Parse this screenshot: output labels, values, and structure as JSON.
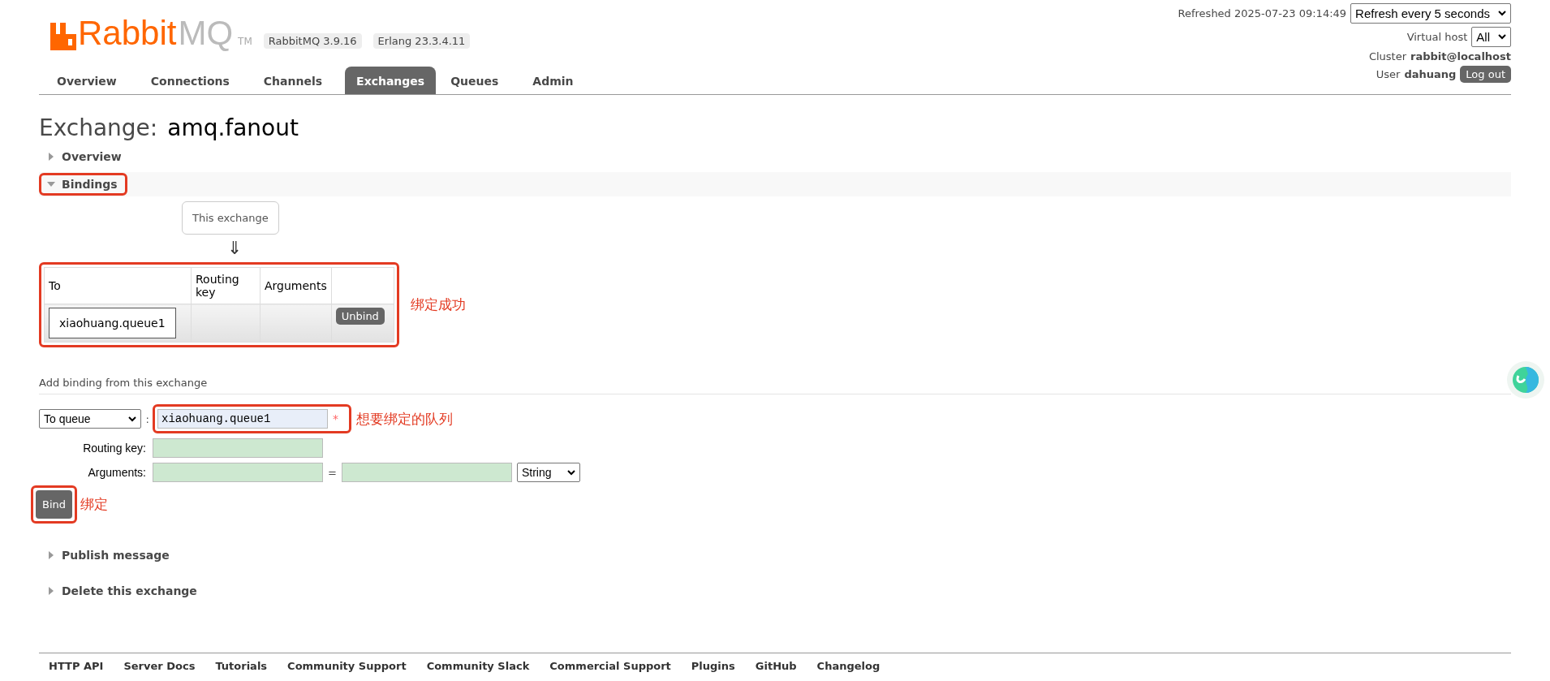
{
  "header": {
    "logo": {
      "brand_primary": "Rabbit",
      "brand_secondary": "MQ",
      "trademark": "TM"
    },
    "versions": [
      "RabbitMQ 3.9.16",
      "Erlang 23.3.4.11"
    ],
    "refreshed": "Refreshed 2025-07-23 09:14:49",
    "refresh_select": "Refresh every 5 seconds",
    "virtual_host": {
      "label": "Virtual host",
      "value": "All"
    },
    "cluster": {
      "label": "Cluster",
      "value": "rabbit@localhost"
    },
    "user": {
      "label": "User",
      "value": "dahuang",
      "logout": "Log out"
    }
  },
  "nav": [
    {
      "label": "Overview",
      "selected": false
    },
    {
      "label": "Connections",
      "selected": false
    },
    {
      "label": "Channels",
      "selected": false
    },
    {
      "label": "Exchanges",
      "selected": true
    },
    {
      "label": "Queues",
      "selected": false
    },
    {
      "label": "Admin",
      "selected": false
    }
  ],
  "title": {
    "prefix": "Exchange:",
    "name": "amq.fanout"
  },
  "overview_section": {
    "label": "Overview",
    "expanded": false
  },
  "bindings": {
    "label": "Bindings",
    "expanded": true,
    "highlighted": true,
    "source": "This exchange",
    "arrow": "⇓",
    "table": {
      "highlighted": true,
      "note": "绑定成功",
      "columns": [
        "To",
        "Routing key",
        "Arguments",
        ""
      ],
      "rows": [
        {
          "to": "xiaohuang.queue1",
          "action": "Unbind"
        }
      ]
    },
    "add_binding": {
      "heading": "Add binding from this exchange",
      "destination_type": "To queue",
      "separator": ":",
      "destination": "xiaohuang.queue1",
      "destination_highlighted": true,
      "required_mark": "*",
      "destination_note": "想要绑定的队列",
      "routing_key_label": "Routing key:",
      "arguments_label": "Arguments:",
      "equals": "=",
      "argument_type": "String",
      "bind_button": "Bind",
      "bind_highlighted": true,
      "bind_note": "绑定"
    }
  },
  "later_sections": [
    {
      "label": "Publish message",
      "expanded": false
    },
    {
      "label": "Delete this exchange",
      "expanded": false
    }
  ],
  "footer_links": [
    "HTTP API",
    "Server Docs",
    "Tutorials",
    "Community Support",
    "Community Slack",
    "Commercial Support",
    "Plugins",
    "GitHub",
    "Changelog"
  ]
}
